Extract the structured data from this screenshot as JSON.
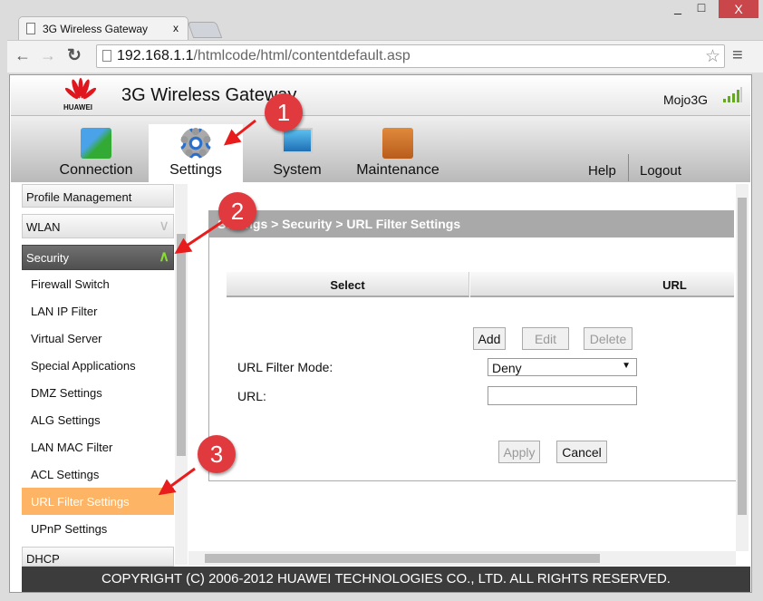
{
  "browser": {
    "tab_title": "3G Wireless Gateway",
    "tab_close": "x",
    "url_host": "192.168.1.1",
    "url_path": "/htmlcode/html/contentdefault.asp",
    "minimize": "_",
    "maximize": "□",
    "close": "X"
  },
  "header": {
    "logo_text": "HUAWEI",
    "title": "3G Wireless Gateway",
    "network_name": "Mojo3G"
  },
  "nav": {
    "items": [
      {
        "label": "Connection"
      },
      {
        "label": "Settings",
        "active": true
      },
      {
        "label": "System"
      },
      {
        "label": "Maintenance"
      }
    ],
    "help": "Help",
    "logout": "Logout"
  },
  "sidebar": {
    "profile": "Profile Management",
    "wlan": "WLAN",
    "security": "Security",
    "items": [
      "Firewall Switch",
      "LAN IP Filter",
      "Virtual Server",
      "Special Applications",
      "DMZ Settings",
      "ALG Settings",
      "LAN MAC Filter",
      "ACL Settings",
      "URL Filter Settings",
      "UPnP Settings"
    ],
    "active_item": "URL Filter Settings",
    "dhcp": "DHCP"
  },
  "main": {
    "breadcrumb": "Settings > Security > URL Filter Settings",
    "table_headers": [
      "Select",
      "URL"
    ],
    "add": "Add",
    "edit": "Edit",
    "delete": "Delete",
    "mode_label": "URL Filter Mode:",
    "mode_value": "Deny",
    "url_label": "URL:",
    "url_value": "",
    "apply": "Apply",
    "cancel": "Cancel"
  },
  "callouts": [
    "1",
    "2",
    "3"
  ],
  "footer": "COPYRIGHT (C) 2006-2012 HUAWEI TECHNOLOGIES CO., LTD. ALL RIGHTS RESERVED.",
  "colors": {
    "accent_active": "#fdb464",
    "callout": "#e0393e",
    "security_header": "#5f5f5f",
    "footer": "#3c3c3c"
  }
}
